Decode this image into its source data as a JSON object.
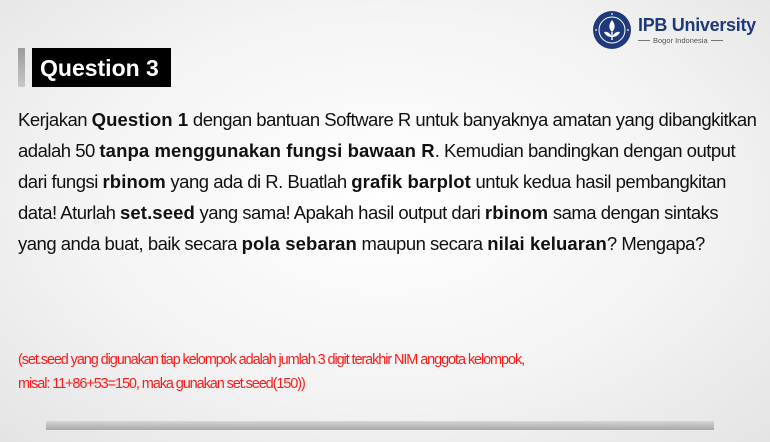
{
  "logo": {
    "name": "IPB University",
    "sub": "Bogor Indonesia",
    "seal_text": "INSTITUT PERTANIAN BOGOR",
    "color": "#1f3a7a"
  },
  "title": "Question 3",
  "body": {
    "t1": "Kerjakan ",
    "b1": "Question 1",
    "t2": " dengan bantuan Software R untuk banyaknya  amatan yang dibangkitkan adalah 50 ",
    "b2": "tanpa menggunakan fungsi  bawaan R",
    "t3": ". Kemudian bandingkan dengan output dari fungsi ",
    "b3": "rbinom",
    "t4": " yang ada di R. Buatlah ",
    "b4": "grafik barplot",
    "t5": " untuk kedua hasil  pembangkitan data! Aturlah ",
    "b5": "set.seed",
    "t6": " yang sama! Apakah hasil  output dari ",
    "b6": "rbinom",
    "t7": " sama dengan sintaks yang anda buat, baik  secara ",
    "b7": "pola sebaran",
    "t8": " maupun secara ",
    "b8": "nilai keluaran",
    "t9": "? Mengapa?"
  },
  "note": {
    "line1": "(set.seed yang digunakan tiap kelompok adalah jumlah 3 digit terakhir NIM anggota kelompok,",
    "line2": "misal: 11+86+53=150, maka gunakan set.seed(150))",
    "color": "#ff1a1a"
  }
}
